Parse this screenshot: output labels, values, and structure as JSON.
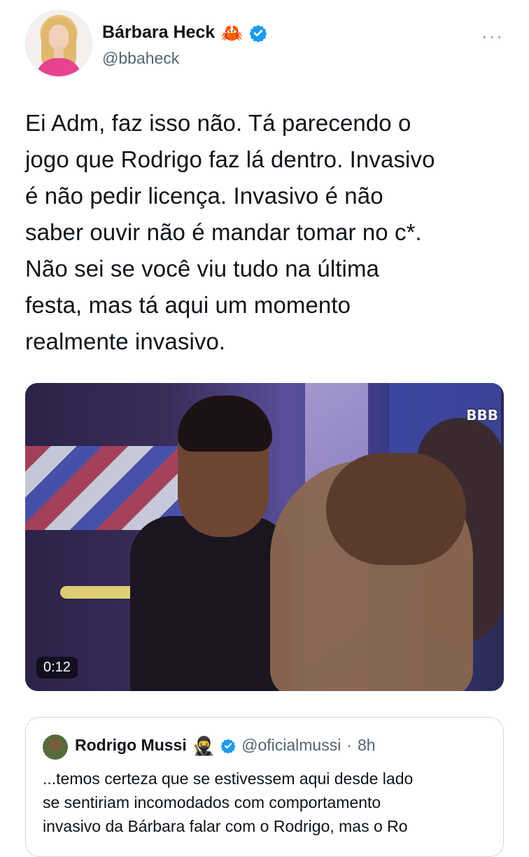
{
  "author": {
    "name": "Bárbara Heck",
    "emoji": "🦀",
    "handle": "@bbaheck",
    "more": "···"
  },
  "tweet_lines": [
    "Ei Adm, faz isso não. Tá parecendo o",
    "jogo que Rodrigo faz lá dentro. Invasivo",
    "é não pedir licença. Invasivo é não",
    "saber ouvir não é mandar tomar no c*.",
    "Não sei se você viu tudo na última",
    "festa, mas tá aqui um momento",
    "realmente invasivo."
  ],
  "video": {
    "logo": "BBB",
    "timestamp": "0:12"
  },
  "quote": {
    "name": "Rodrigo Mussi",
    "emoji": "🥷",
    "handle": "@oficialmussi",
    "separator": "·",
    "time": "8h",
    "lines": [
      "...temos certeza que se estivessem aqui desde lado",
      "se sentiriam incomodados com comportamento",
      "invasivo da Bárbara falar com o Rodrigo, mas o Ro"
    ]
  },
  "colors": {
    "verified": "#1d9bf0",
    "secondary_text": "#536471",
    "border": "#cfd9de"
  }
}
